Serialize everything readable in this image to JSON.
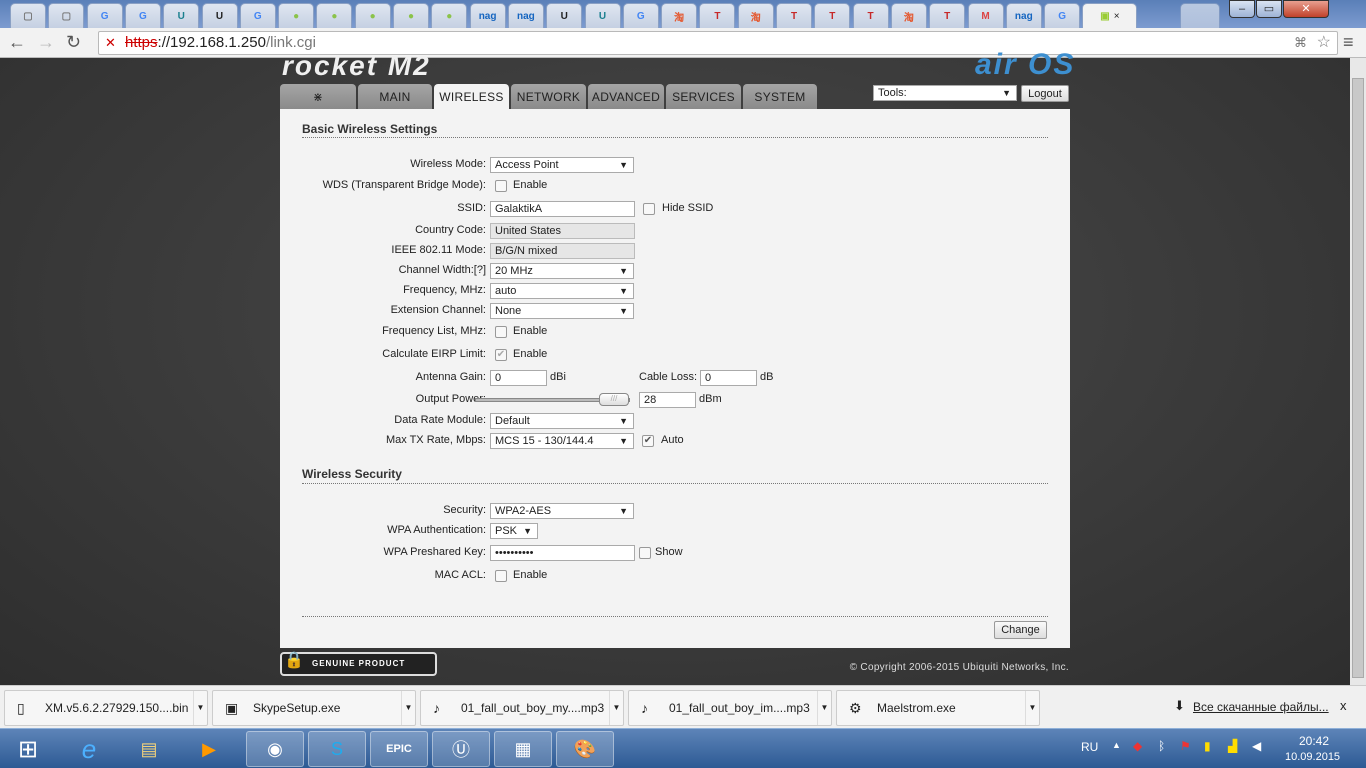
{
  "browser": {
    "tabs": [
      {
        "icon": "page-icon",
        "glyph": "▢"
      },
      {
        "icon": "page-icon",
        "glyph": "▢"
      },
      {
        "icon": "google-icon",
        "glyph": "G"
      },
      {
        "icon": "google-icon",
        "glyph": "G"
      },
      {
        "icon": "unreal-forum-icon",
        "glyph": "U"
      },
      {
        "icon": "unreal-icon",
        "glyph": "U"
      },
      {
        "icon": "google-icon",
        "glyph": "G"
      },
      {
        "icon": "apps-icon",
        "glyph": "●"
      },
      {
        "icon": "apps-icon",
        "glyph": "●"
      },
      {
        "icon": "apps-icon",
        "glyph": "●"
      },
      {
        "icon": "apps-icon",
        "glyph": "●"
      },
      {
        "icon": "apps-icon",
        "glyph": "●"
      },
      {
        "icon": "nag-icon",
        "glyph": "nag"
      },
      {
        "icon": "nag-icon",
        "glyph": "nag"
      },
      {
        "icon": "unreal-icon",
        "glyph": "U"
      },
      {
        "icon": "unreal-forum-icon",
        "glyph": "U"
      },
      {
        "icon": "google-icon",
        "glyph": "G"
      },
      {
        "icon": "taobao-icon",
        "glyph": "淘"
      },
      {
        "icon": "t-icon",
        "glyph": "T"
      },
      {
        "icon": "taobao-icon",
        "glyph": "淘"
      },
      {
        "icon": "t-icon",
        "glyph": "T"
      },
      {
        "icon": "t-icon",
        "glyph": "T"
      },
      {
        "icon": "t-icon",
        "glyph": "T"
      },
      {
        "icon": "taobao-icon",
        "glyph": "淘"
      },
      {
        "icon": "t-icon",
        "glyph": "T"
      },
      {
        "icon": "gmail-icon",
        "glyph": "M"
      },
      {
        "icon": "nag-icon",
        "glyph": "nag"
      },
      {
        "icon": "google-icon",
        "glyph": "G"
      },
      {
        "icon": "router-icon",
        "glyph": "▣"
      }
    ],
    "close_glyph": "×",
    "url_scheme": "https",
    "url_host": "://192.168.1.250",
    "url_path": "/link.cgi"
  },
  "device": {
    "logo": "rocket M2",
    "brand": "air OS"
  },
  "nav": {
    "tabs": [
      "MAIN",
      "WIRELESS",
      "NETWORK",
      "ADVANCED",
      "SERVICES",
      "SYSTEM"
    ],
    "tools_label": "Tools:",
    "logout": "Logout"
  },
  "basic": {
    "title": "Basic Wireless Settings",
    "wireless_mode_label": "Wireless Mode:",
    "wireless_mode": "Access Point",
    "wds_label": "WDS (Transparent Bridge Mode):",
    "wds_enable": "Enable",
    "ssid_label": "SSID:",
    "ssid": "GalaktikA",
    "hide_ssid": "Hide SSID",
    "country_label": "Country Code:",
    "country": "United States",
    "ieee_label": "IEEE 802.11 Mode:",
    "ieee": "B/G/N mixed",
    "channel_width_label": "Channel Width:[?]",
    "channel_width": "20 MHz",
    "frequency_label": "Frequency, MHz:",
    "frequency": "auto",
    "ext_channel_label": "Extension Channel:",
    "ext_channel": "None",
    "freq_list_label": "Frequency List, MHz:",
    "freq_list_enable": "Enable",
    "eirp_label": "Calculate EIRP Limit:",
    "eirp_enable": "Enable",
    "antenna_gain_label": "Antenna Gain:",
    "antenna_gain": "0",
    "antenna_unit": "dBi",
    "cable_loss_label": "Cable Loss:",
    "cable_loss": "0",
    "cable_unit": "dB",
    "output_power_label": "Output Power:",
    "output_power": "28",
    "output_unit": "dBm",
    "output_power_fraction": 1.0,
    "data_rate_label": "Data Rate Module:",
    "data_rate": "Default",
    "max_tx_label": "Max TX Rate, Mbps:",
    "max_tx": "MCS 15 - 130/144.4",
    "auto": "Auto"
  },
  "security": {
    "title": "Wireless Security",
    "security_label": "Security:",
    "security": "WPA2-AES",
    "wpa_auth_label": "WPA Authentication:",
    "wpa_auth": "PSK",
    "psk_label": "WPA Preshared Key:",
    "psk": "••••••••••",
    "show": "Show",
    "mac_acl_label": "MAC ACL:",
    "mac_acl_enable": "Enable"
  },
  "change": "Change",
  "footer": {
    "badge": "GENUINE PRODUCT",
    "copyright": "© Copyright 2006-2015 Ubiquiti Networks, Inc."
  },
  "downloads": {
    "items": [
      "XM.v5.6.2.27929.150....bin",
      "SkypeSetup.exe",
      "01_fall_out_boy_my....mp3",
      "01_fall_out_boy_im....mp3",
      "Maelstrom.exe"
    ],
    "all": "Все скачанные файлы...",
    "close": "x"
  },
  "taskbar": {
    "lang": "RU",
    "time": "20:42",
    "date": "10.09.2015"
  }
}
